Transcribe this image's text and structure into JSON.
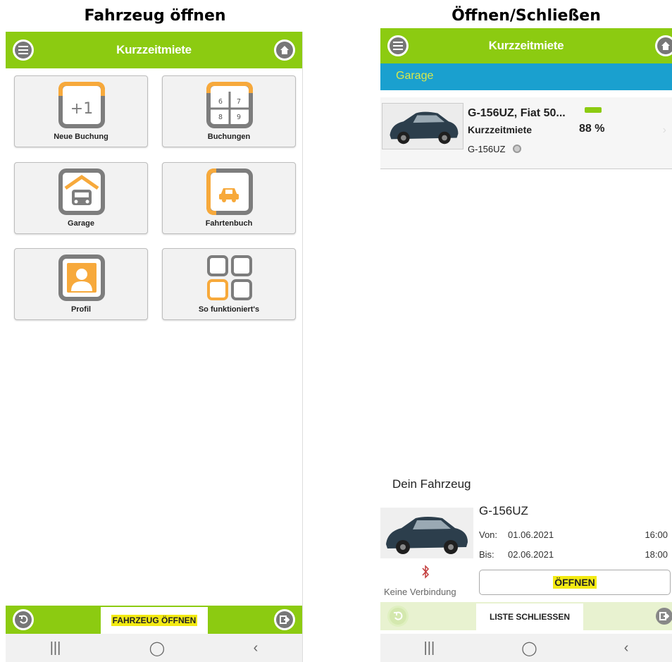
{
  "captions": {
    "left": "Fahrzeug öffnen",
    "right": "Öffnen/Schließen"
  },
  "left": {
    "title": "Kurzzeitmiete",
    "tiles": [
      {
        "label": "Neue Buchung",
        "icon": "plus-one-icon",
        "icon_text": "+1"
      },
      {
        "label": "Buchungen",
        "icon": "calendar-grid-icon",
        "icon_digits": [
          "6",
          "7",
          "8",
          "9"
        ]
      },
      {
        "label": "Garage",
        "icon": "garage-icon"
      },
      {
        "label": "Fahrtenbuch",
        "icon": "logbook-car-icon"
      },
      {
        "label": "Profil",
        "icon": "profile-icon"
      },
      {
        "label": "So funktioniert's",
        "icon": "how-it-works-grid-icon"
      }
    ],
    "bottom_tab": "FAHRZEUG ÖFFNEN",
    "nav": [
      "|||",
      "◯",
      "‹"
    ]
  },
  "right": {
    "title": "Kurzzeitmiete",
    "section": "Garage",
    "vehicle": {
      "name": "G-156UZ, Fiat 50...",
      "type": "Kurzzeitmiete",
      "battery": "88 %",
      "plate": "G-156UZ"
    },
    "panel": {
      "heading": "Dein Fahrzeug",
      "plate": "G-156UZ",
      "von_label": "Von:",
      "von_date": "01.06.2021",
      "von_time": "16:00",
      "bis_label": "Bis:",
      "bis_date": "02.06.2021",
      "bis_time": "18:00",
      "connection": "Keine Verbindung",
      "open_button": "ÖFFNEN"
    },
    "bottom_tab": "LISTE SCHLIESSEN",
    "nav": [
      "|||",
      "◯",
      "‹"
    ]
  },
  "colors": {
    "brand_green": "#8ccb11",
    "garage_blue": "#1aa0cf",
    "accent_orange": "#f7a93b",
    "icon_gray": "#7d7d7d",
    "highlight_yellow": "#f3ea13"
  }
}
